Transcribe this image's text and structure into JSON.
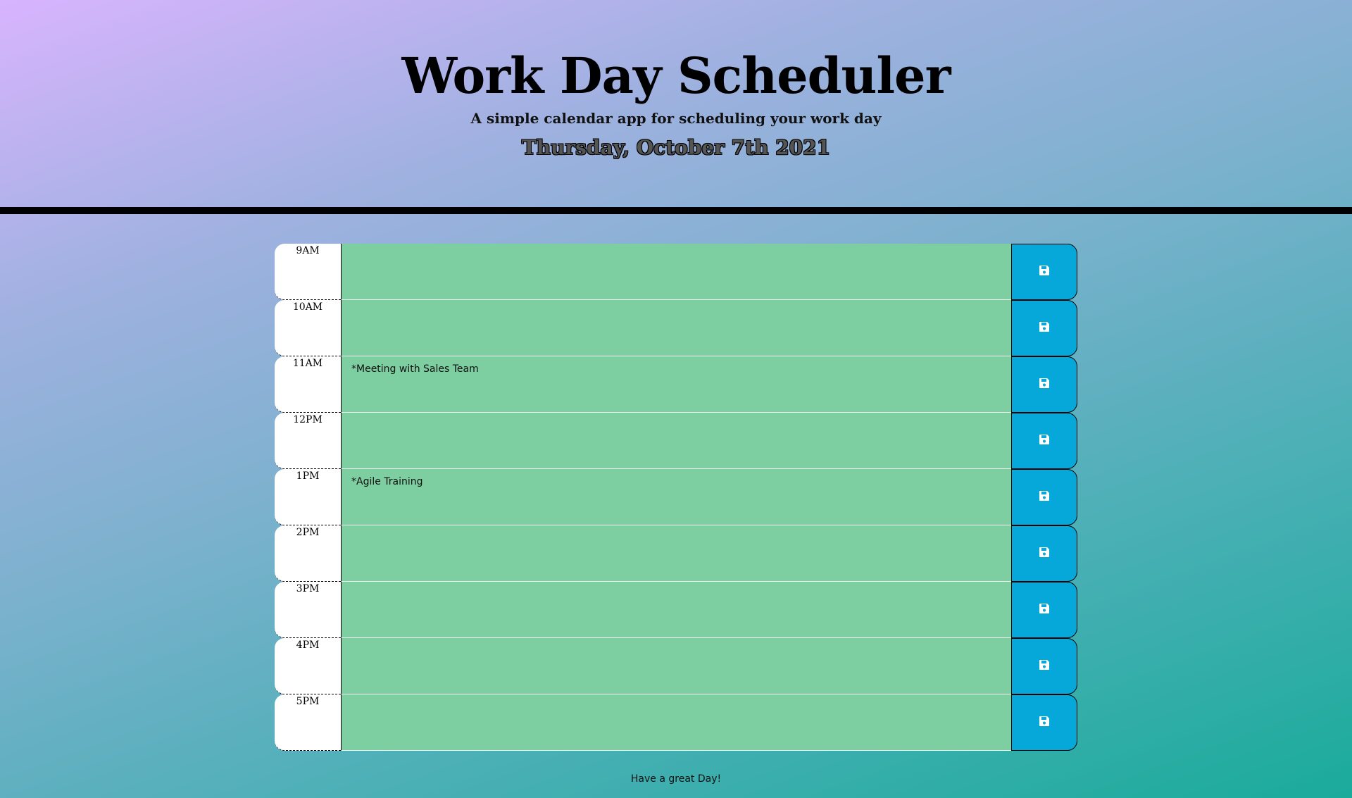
{
  "header": {
    "title": "Work Day Scheduler",
    "subtitle": "A simple calendar app for scheduling your work day",
    "current_day": "Thursday, October 7th 2021"
  },
  "timeblocks": [
    {
      "hour": "9AM",
      "description": ""
    },
    {
      "hour": "10AM",
      "description": ""
    },
    {
      "hour": "11AM",
      "description": "*Meeting with Sales Team"
    },
    {
      "hour": "12PM",
      "description": ""
    },
    {
      "hour": "1PM",
      "description": "*Agile Training"
    },
    {
      "hour": "2PM",
      "description": ""
    },
    {
      "hour": "3PM",
      "description": ""
    },
    {
      "hour": "4PM",
      "description": ""
    },
    {
      "hour": "5PM",
      "description": ""
    }
  ],
  "footer": {
    "text": "Have a great Day!"
  },
  "colors": {
    "future_block": "#7dcfa1",
    "save_button": "#05a8d8",
    "icon": "save-icon"
  }
}
